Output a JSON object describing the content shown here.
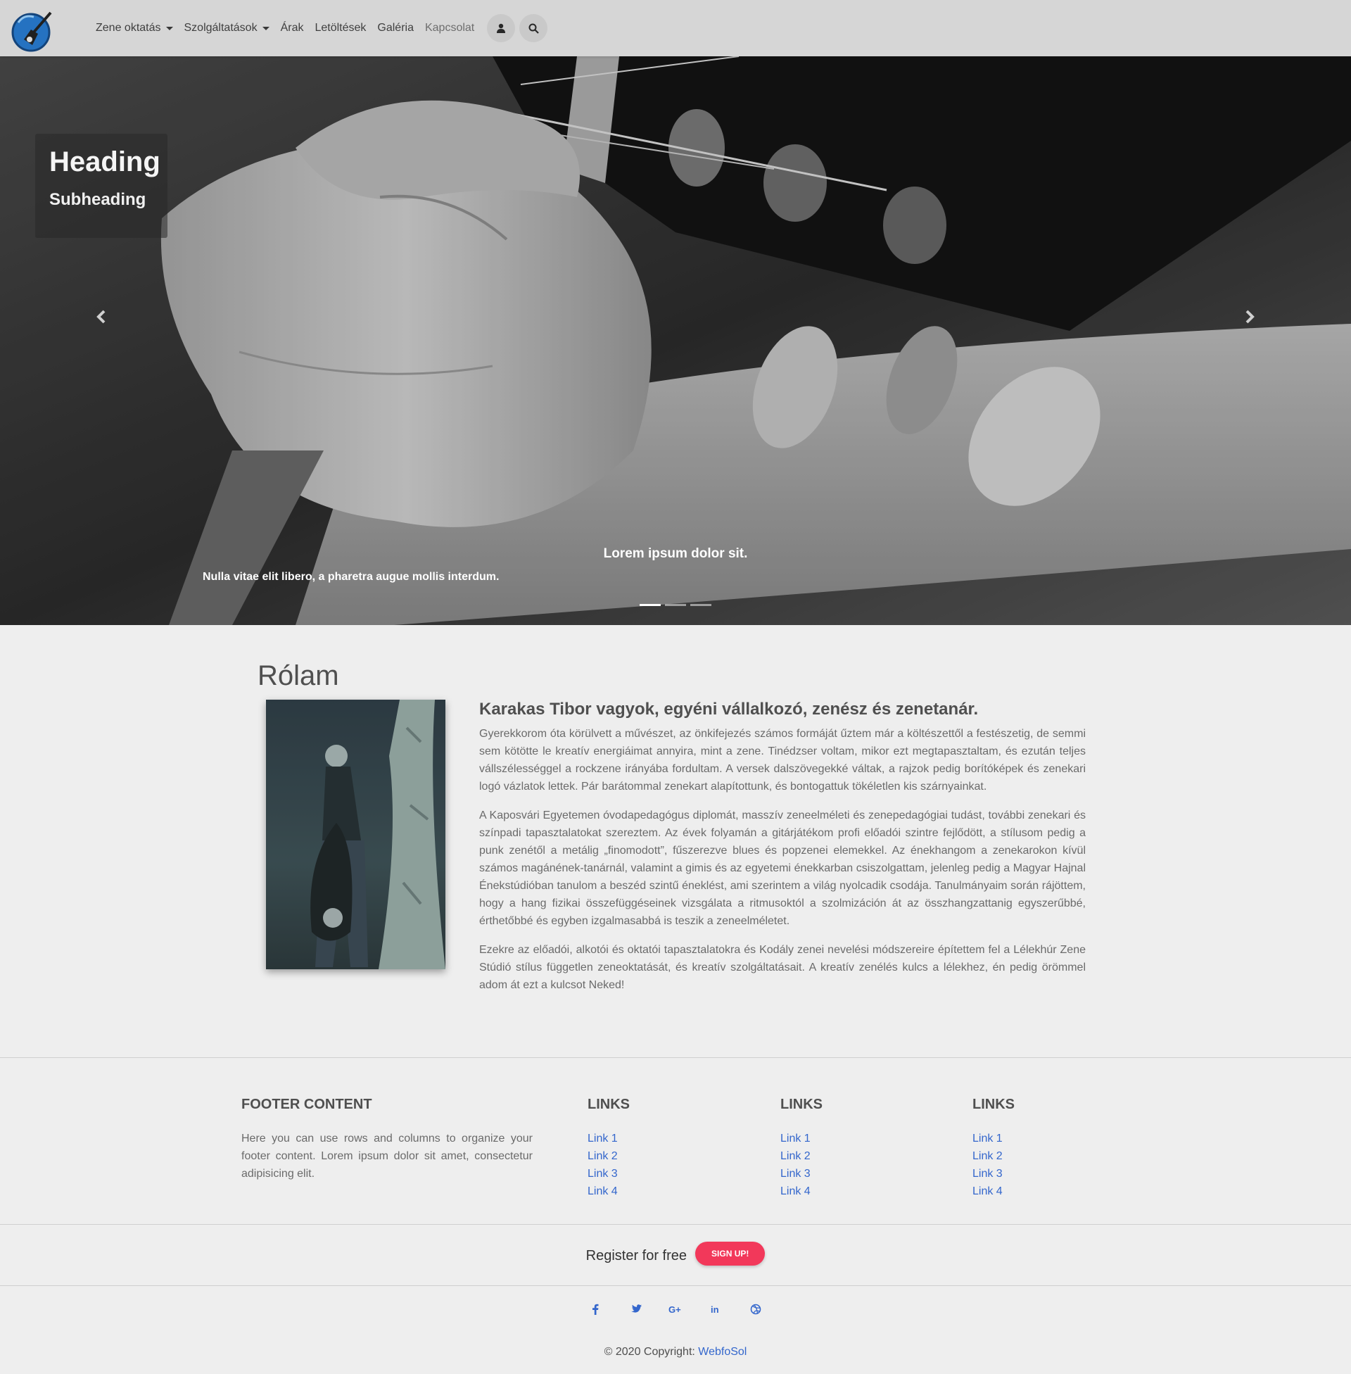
{
  "nav": {
    "items": [
      {
        "label": "Zene oktatás",
        "dropdown": true
      },
      {
        "label": "Szolgáltatások",
        "dropdown": true
      },
      {
        "label": "Árak"
      },
      {
        "label": "Letöltések"
      },
      {
        "label": "Galéria"
      },
      {
        "label": "Kapcsolat"
      }
    ],
    "icons": [
      "user-icon",
      "search-icon"
    ]
  },
  "hero": {
    "heading": "Heading",
    "subheading": "Subheading",
    "left_caption": "Nulla vitae elit libero, a pharetra augue mollis interdum.",
    "center_caption": "Lorem ipsum dolor sit.",
    "slides": 3,
    "active_slide": 1
  },
  "about": {
    "title": "Rólam",
    "heading": "Karakas Tibor vagyok, egyéni vállalkozó, zenész és zenetanár.",
    "paragraphs": [
      "Gyerekkorom óta körülvett a művészet, az önkifejezés számos formáját űztem már a költészettől a festészetig, de semmi sem kötötte le kreatív energiáimat annyira, mint a zene. Tinédzser voltam, mikor ezt megtapasztaltam, és ezután teljes vállszélességgel a rockzene irányába fordultam. A versek dalszövegekké váltak, a rajzok pedig borítóképek és zenekari logó vázlatok lettek. Pár barátommal zenekart alapítottunk, és bontogattuk tökéletlen kis szárnyainkat.",
      "A Kaposvári Egyetemen óvodapedagógus diplomát, masszív zeneelméleti és zenepedagógiai tudást, további zenekari és színpadi tapasztalatokat szereztem. Az évek folyamán a gitárjátékom profi előadói szintre fejlődött, a stílusom pedig a punk zenétől a metálig „finomodott”, fűszerezve blues és popzenei elemekkel. Az énekhangom a zenekarokon kívül számos magánének-tanárnál, valamint a gimis és az egyetemi énekkarban csiszolgattam, jelenleg pedig a Magyar Hajnal Énekstúdióban tanulom a beszéd szintű éneklést, ami szerintem a világ nyolcadik csodája. Tanulmányaim során rájöttem, hogy a hang fizikai összefüggéseinek vizsgálata a ritmusoktól a szolmizáción át az összhangzattanig egyszerűbbé, érthetőbbé és egyben izgalmasabbá is teszik a zeneelméletet.",
      "Ezekre az előadói, alkotói és oktatói tapasztalatokra és Kodály zenei nevelési módszereire építettem fel a Lélekhúr Zene Stúdió stílus független zeneoktatását, és kreatív szolgáltatásait. A kreatív zenélés kulcs a lélekhez, én pedig örömmel adom át ezt a kulcsot Neked!"
    ]
  },
  "footer": {
    "content_title": "FOOTER CONTENT",
    "content_text": "Here you can use rows and columns to organize your footer content. Lorem ipsum dolor sit amet, consectetur adipisicing elit.",
    "link_columns": [
      {
        "title": "LINKS",
        "links": [
          "Link 1",
          "Link 2",
          "Link 3",
          "Link 4"
        ]
      },
      {
        "title": "LINKS",
        "links": [
          "Link 1",
          "Link 2",
          "Link 3",
          "Link 4"
        ]
      },
      {
        "title": "LINKS",
        "links": [
          "Link 1",
          "Link 2",
          "Link 3",
          "Link 4"
        ]
      }
    ],
    "register_text": "Register for free",
    "signup_label": "SIGN UP!",
    "social": [
      "facebook-icon",
      "twitter-icon",
      "google-plus-icon",
      "linkedin-icon",
      "dribbble-icon"
    ],
    "copyright_prefix": "© 2020 Copyright: ",
    "copyright_link": "WebfoSol"
  },
  "colors": {
    "link": "#3366cc",
    "signup": "#f2385a",
    "background": "#eeeeee",
    "navbar": "#d6d6d6"
  }
}
